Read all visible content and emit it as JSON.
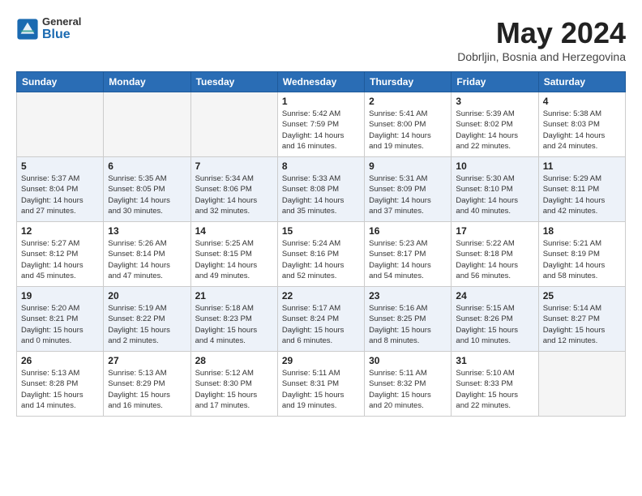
{
  "header": {
    "logo_general": "General",
    "logo_blue": "Blue",
    "title": "May 2024",
    "location": "Dobrljin, Bosnia and Herzegovina"
  },
  "weekdays": [
    "Sunday",
    "Monday",
    "Tuesday",
    "Wednesday",
    "Thursday",
    "Friday",
    "Saturday"
  ],
  "weeks": [
    [
      {
        "day": "",
        "info": ""
      },
      {
        "day": "",
        "info": ""
      },
      {
        "day": "",
        "info": ""
      },
      {
        "day": "1",
        "info": "Sunrise: 5:42 AM\nSunset: 7:59 PM\nDaylight: 14 hours\nand 16 minutes."
      },
      {
        "day": "2",
        "info": "Sunrise: 5:41 AM\nSunset: 8:00 PM\nDaylight: 14 hours\nand 19 minutes."
      },
      {
        "day": "3",
        "info": "Sunrise: 5:39 AM\nSunset: 8:02 PM\nDaylight: 14 hours\nand 22 minutes."
      },
      {
        "day": "4",
        "info": "Sunrise: 5:38 AM\nSunset: 8:03 PM\nDaylight: 14 hours\nand 24 minutes."
      }
    ],
    [
      {
        "day": "5",
        "info": "Sunrise: 5:37 AM\nSunset: 8:04 PM\nDaylight: 14 hours\nand 27 minutes."
      },
      {
        "day": "6",
        "info": "Sunrise: 5:35 AM\nSunset: 8:05 PM\nDaylight: 14 hours\nand 30 minutes."
      },
      {
        "day": "7",
        "info": "Sunrise: 5:34 AM\nSunset: 8:06 PM\nDaylight: 14 hours\nand 32 minutes."
      },
      {
        "day": "8",
        "info": "Sunrise: 5:33 AM\nSunset: 8:08 PM\nDaylight: 14 hours\nand 35 minutes."
      },
      {
        "day": "9",
        "info": "Sunrise: 5:31 AM\nSunset: 8:09 PM\nDaylight: 14 hours\nand 37 minutes."
      },
      {
        "day": "10",
        "info": "Sunrise: 5:30 AM\nSunset: 8:10 PM\nDaylight: 14 hours\nand 40 minutes."
      },
      {
        "day": "11",
        "info": "Sunrise: 5:29 AM\nSunset: 8:11 PM\nDaylight: 14 hours\nand 42 minutes."
      }
    ],
    [
      {
        "day": "12",
        "info": "Sunrise: 5:27 AM\nSunset: 8:12 PM\nDaylight: 14 hours\nand 45 minutes."
      },
      {
        "day": "13",
        "info": "Sunrise: 5:26 AM\nSunset: 8:14 PM\nDaylight: 14 hours\nand 47 minutes."
      },
      {
        "day": "14",
        "info": "Sunrise: 5:25 AM\nSunset: 8:15 PM\nDaylight: 14 hours\nand 49 minutes."
      },
      {
        "day": "15",
        "info": "Sunrise: 5:24 AM\nSunset: 8:16 PM\nDaylight: 14 hours\nand 52 minutes."
      },
      {
        "day": "16",
        "info": "Sunrise: 5:23 AM\nSunset: 8:17 PM\nDaylight: 14 hours\nand 54 minutes."
      },
      {
        "day": "17",
        "info": "Sunrise: 5:22 AM\nSunset: 8:18 PM\nDaylight: 14 hours\nand 56 minutes."
      },
      {
        "day": "18",
        "info": "Sunrise: 5:21 AM\nSunset: 8:19 PM\nDaylight: 14 hours\nand 58 minutes."
      }
    ],
    [
      {
        "day": "19",
        "info": "Sunrise: 5:20 AM\nSunset: 8:21 PM\nDaylight: 15 hours\nand 0 minutes."
      },
      {
        "day": "20",
        "info": "Sunrise: 5:19 AM\nSunset: 8:22 PM\nDaylight: 15 hours\nand 2 minutes."
      },
      {
        "day": "21",
        "info": "Sunrise: 5:18 AM\nSunset: 8:23 PM\nDaylight: 15 hours\nand 4 minutes."
      },
      {
        "day": "22",
        "info": "Sunrise: 5:17 AM\nSunset: 8:24 PM\nDaylight: 15 hours\nand 6 minutes."
      },
      {
        "day": "23",
        "info": "Sunrise: 5:16 AM\nSunset: 8:25 PM\nDaylight: 15 hours\nand 8 minutes."
      },
      {
        "day": "24",
        "info": "Sunrise: 5:15 AM\nSunset: 8:26 PM\nDaylight: 15 hours\nand 10 minutes."
      },
      {
        "day": "25",
        "info": "Sunrise: 5:14 AM\nSunset: 8:27 PM\nDaylight: 15 hours\nand 12 minutes."
      }
    ],
    [
      {
        "day": "26",
        "info": "Sunrise: 5:13 AM\nSunset: 8:28 PM\nDaylight: 15 hours\nand 14 minutes."
      },
      {
        "day": "27",
        "info": "Sunrise: 5:13 AM\nSunset: 8:29 PM\nDaylight: 15 hours\nand 16 minutes."
      },
      {
        "day": "28",
        "info": "Sunrise: 5:12 AM\nSunset: 8:30 PM\nDaylight: 15 hours\nand 17 minutes."
      },
      {
        "day": "29",
        "info": "Sunrise: 5:11 AM\nSunset: 8:31 PM\nDaylight: 15 hours\nand 19 minutes."
      },
      {
        "day": "30",
        "info": "Sunrise: 5:11 AM\nSunset: 8:32 PM\nDaylight: 15 hours\nand 20 minutes."
      },
      {
        "day": "31",
        "info": "Sunrise: 5:10 AM\nSunset: 8:33 PM\nDaylight: 15 hours\nand 22 minutes."
      },
      {
        "day": "",
        "info": ""
      }
    ]
  ]
}
